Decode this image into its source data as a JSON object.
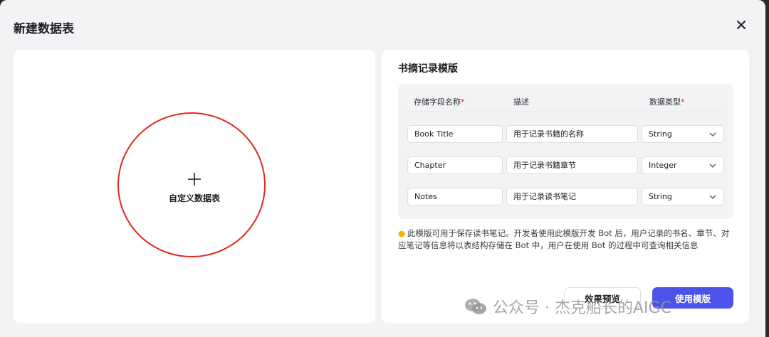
{
  "dialog": {
    "title": "新建数据表"
  },
  "custom_table": {
    "label": "自定义数据表"
  },
  "template": {
    "title": "书摘记录模版",
    "columns": {
      "name": "存储字段名称",
      "description": "描述",
      "type": "数据类型",
      "required_mark": "*"
    },
    "rows": [
      {
        "name": "Book Title",
        "description": "用于记录书籍的名称",
        "type": "String"
      },
      {
        "name": "Chapter",
        "description": "用于记录书籍章节",
        "type": "Integer"
      },
      {
        "name": "Notes",
        "description": "用于记录读书笔记",
        "type": "String"
      }
    ],
    "tip_line1": "此模版可用于保存读书笔记。开发者使用此模版开发 Bot 后，用户记录的书名、章节、对",
    "tip_line2": "应笔记等信息将以表结构存储在 Bot 中，用户在使用 Bot 的过程中可查询相关信息"
  },
  "buttons": {
    "preview": "效果预览",
    "use_template": "使用模版"
  },
  "watermark": {
    "text": "公众号 · 杰克船长的AIGC"
  },
  "colors": {
    "accent": "#4d53e8",
    "required": "#e0271c",
    "highlight_circle": "#e0271c"
  }
}
